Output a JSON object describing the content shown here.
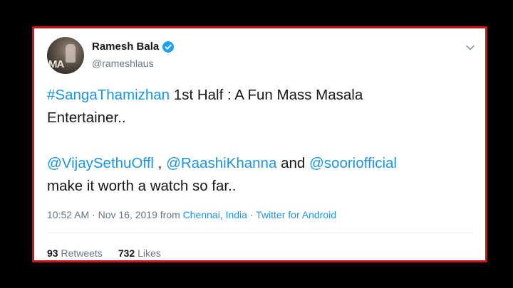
{
  "tweet": {
    "author_name": "Ramesh Bala",
    "author_handle": "@rameshlaus",
    "avatar_label": "MA",
    "line1_hashtag": "#SangaThamizhan",
    "line1_rest": " 1st Half : A Fun Mass Masala",
    "line2": "Entertainer..",
    "mention1": "@VijaySethuOffl",
    "sep1": " , ",
    "mention2": "@RaashiKhanna",
    "and_text": " and ",
    "mention3": "@sooriofficial",
    "line4": " make it worth a watch so far..",
    "time": "10:52 AM · Nov 16, 2019 from ",
    "location": "Chennai, India",
    "meta_sep": " · ",
    "source": "Twitter for Android",
    "retweets_count": "93",
    "retweets_label": " Retweets",
    "likes_count": "732",
    "likes_label": " Likes"
  },
  "colors": {
    "border": "#d0121b",
    "link": "#1b95e0",
    "muted": "#657786",
    "text": "#14171a"
  },
  "icons": {
    "verified": "verified-badge-icon",
    "menu": "chevron-down-icon"
  }
}
